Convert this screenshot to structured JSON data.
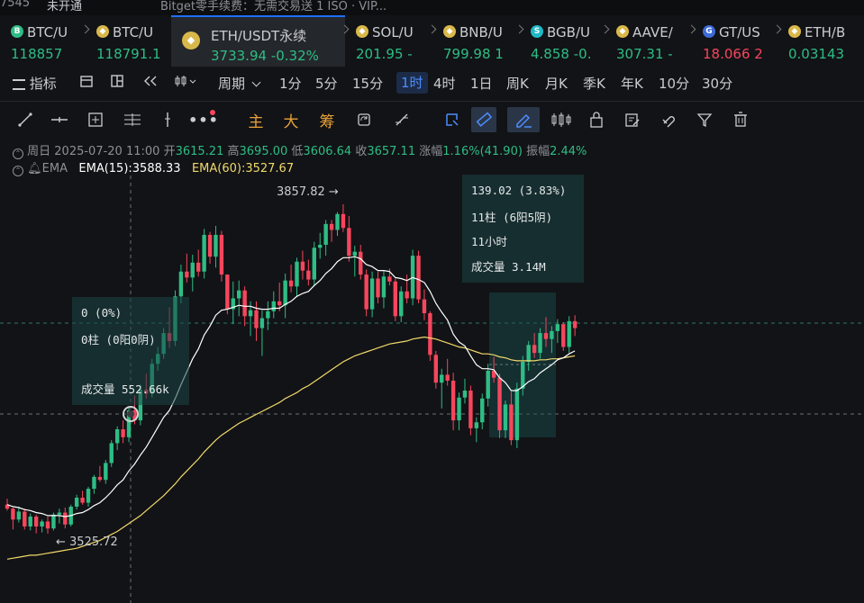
{
  "top_strip": {
    "left_text": "7545",
    "tab_label": "未开通",
    "notice": "Bitget零手续费：无需交易送 1 ISO · VIP..."
  },
  "tabs": [
    {
      "name": "BTC/U",
      "price": "118857",
      "change": "",
      "color": "#2ebd85",
      "icon": "b-coin-icon"
    },
    {
      "name": "BTC/U",
      "price": "118791.1",
      "change": "",
      "color": "#2ebd85",
      "icon": "bnb-coin-icon"
    },
    {
      "name": "ETH/USDT永续",
      "price": "3733.94",
      "change": "-0.32%",
      "color": "#2ebd85",
      "icon": "bnb-coin-icon",
      "active": true
    },
    {
      "name": "SOL/U",
      "price": "201.95",
      "change": "-",
      "color": "#2ebd85",
      "icon": "bnb-coin-icon"
    },
    {
      "name": "BNB/U",
      "price": "799.98",
      "change": "1",
      "color": "#2ebd85",
      "icon": "bnb-coin-icon"
    },
    {
      "name": "BGB/U",
      "price": "4.858",
      "change": "-0.",
      "color": "#2ebd85",
      "icon": "bgb-coin-icon"
    },
    {
      "name": "AAVE/",
      "price": "307.31",
      "change": "-",
      "color": "#2ebd85",
      "icon": "bnb-coin-icon"
    },
    {
      "name": "GT/US",
      "price": "18.066",
      "change": "2",
      "color": "#f6465d",
      "icon": "gt-coin-icon"
    },
    {
      "name": "ETH/B",
      "price": "0.03143",
      "change": "",
      "color": "#2ebd85",
      "icon": "bnb-coin-icon"
    }
  ],
  "toolbar": {
    "indicator_label": "指标",
    "period_label": "周期",
    "periods": [
      "1分",
      "5分",
      "15分",
      "1时",
      "4时",
      "1日",
      "周K",
      "月K",
      "季K",
      "年K",
      "10分",
      "30分"
    ],
    "selected_period": "1时"
  },
  "drawing_tools": {
    "text_tools": [
      "主",
      "大",
      "筹"
    ]
  },
  "ohlc": {
    "date": "周日 2025-07-20 11:00",
    "open_label": "开",
    "open": "3615.21",
    "high_label": "高",
    "high": "3695.00",
    "low_label": "低",
    "low": "3606.64",
    "close_label": "收",
    "close": "3657.11",
    "change_label": "涨幅",
    "change": "1.16%(41.90)",
    "amp_label": "振幅",
    "amp": "2.44%"
  },
  "ema": {
    "label": "EMA",
    "ema15_label": "EMA(15):",
    "ema15": "3588.33",
    "ema60_label": "EMA(60):",
    "ema60": "3527.67",
    "ema15_color": "#ffffff",
    "ema60_color": "#f0d96b"
  },
  "annotations": {
    "high_label": "3857.82 →",
    "low_label": "← 3525.72",
    "measure_left": {
      "line1": "0 (0%)",
      "line2": "0柱 (0阳0阴)",
      "line3": "成交量 552.66k"
    },
    "measure_right": {
      "line1": "139.02 (3.83%)",
      "line2": "11柱 (6阳5阴)",
      "line3": "11小时",
      "line4": "成交量 3.14M"
    }
  },
  "chart_data": {
    "type": "candlestick",
    "interval": "1h",
    "high": 3857.82,
    "low": 3525.72,
    "up_color": "#2ebd85",
    "down_color": "#f6465d",
    "ema_series": [
      {
        "name": "EMA(15)"
      },
      {
        "name": "EMA(60)"
      }
    ],
    "ohlc": [
      [
        3555,
        3561,
        3549,
        3551
      ],
      [
        3551,
        3552,
        3530,
        3540
      ],
      [
        3540,
        3553,
        3537,
        3548
      ],
      [
        3548,
        3551,
        3530,
        3533
      ],
      [
        3533,
        3546,
        3529,
        3543
      ],
      [
        3543,
        3545,
        3526,
        3533
      ],
      [
        3533,
        3540,
        3527,
        3538
      ],
      [
        3538,
        3543,
        3525.72,
        3531
      ],
      [
        3531,
        3547,
        3529,
        3545
      ],
      [
        3545,
        3551,
        3536,
        3547
      ],
      [
        3547,
        3552,
        3531,
        3535
      ],
      [
        3535,
        3555,
        3533,
        3553
      ],
      [
        3553,
        3565,
        3550,
        3562
      ],
      [
        3562,
        3569,
        3555,
        3557
      ],
      [
        3557,
        3573,
        3553,
        3571
      ],
      [
        3571,
        3585,
        3566,
        3583
      ],
      [
        3583,
        3594,
        3578,
        3580
      ],
      [
        3580,
        3600,
        3576,
        3597
      ],
      [
        3597,
        3620,
        3593,
        3617
      ],
      [
        3617,
        3634,
        3610,
        3631
      ],
      [
        3631,
        3640,
        3617,
        3623
      ],
      [
        3623,
        3654,
        3618,
        3650
      ],
      [
        3650,
        3665,
        3636,
        3640
      ],
      [
        3640,
        3676,
        3635,
        3671
      ],
      [
        3671,
        3687,
        3662,
        3667
      ],
      [
        3667,
        3702,
        3663,
        3697
      ],
      [
        3697,
        3714,
        3690,
        3707
      ],
      [
        3707,
        3733,
        3702,
        3728
      ],
      [
        3728,
        3754,
        3713,
        3720
      ],
      [
        3720,
        3771,
        3715,
        3765
      ],
      [
        3765,
        3797,
        3758,
        3790
      ],
      [
        3790,
        3808,
        3779,
        3784
      ],
      [
        3784,
        3807,
        3770,
        3799
      ],
      [
        3799,
        3812,
        3785,
        3790
      ],
      [
        3790,
        3833,
        3783,
        3827
      ],
      [
        3827,
        3830,
        3798,
        3805
      ],
      [
        3805,
        3836,
        3794,
        3827
      ],
      [
        3827,
        3831,
        3780,
        3787
      ],
      [
        3787,
        3787,
        3747,
        3752
      ],
      [
        3752,
        3780,
        3737,
        3763
      ],
      [
        3763,
        3781,
        3745,
        3771
      ],
      [
        3771,
        3775,
        3735,
        3745
      ],
      [
        3745,
        3760,
        3725,
        3751
      ],
      [
        3751,
        3760,
        3720,
        3733
      ],
      [
        3733,
        3751,
        3705,
        3743
      ],
      [
        3743,
        3760,
        3731,
        3750
      ],
      [
        3750,
        3770,
        3743,
        3760
      ],
      [
        3760,
        3779,
        3750,
        3756
      ],
      [
        3756,
        3788,
        3743,
        3781
      ],
      [
        3781,
        3797,
        3769,
        3775
      ],
      [
        3775,
        3804,
        3765,
        3800
      ],
      [
        3800,
        3811,
        3782,
        3791
      ],
      [
        3791,
        3802,
        3776,
        3782
      ],
      [
        3782,
        3820,
        3775,
        3814
      ],
      [
        3814,
        3829,
        3803,
        3817
      ],
      [
        3817,
        3842,
        3806,
        3838
      ],
      [
        3838,
        3842,
        3820,
        3832
      ],
      [
        3832,
        3850,
        3826,
        3848
      ],
      [
        3848,
        3857.82,
        3830,
        3834
      ],
      [
        3834,
        3846,
        3800,
        3806
      ],
      [
        3806,
        3816,
        3785,
        3810
      ],
      [
        3810,
        3817,
        3782,
        3787
      ],
      [
        3787,
        3792,
        3745,
        3752
      ],
      [
        3752,
        3790,
        3744,
        3783
      ],
      [
        3783,
        3790,
        3758,
        3764
      ],
      [
        3764,
        3791,
        3753,
        3785
      ],
      [
        3785,
        3793,
        3776,
        3780
      ],
      [
        3780,
        3783,
        3740,
        3745
      ],
      [
        3745,
        3775,
        3739,
        3770
      ],
      [
        3770,
        3787,
        3758,
        3763
      ],
      [
        3763,
        3812,
        3756,
        3806
      ],
      [
        3806,
        3811,
        3758,
        3762
      ],
      [
        3762,
        3772,
        3741,
        3748
      ],
      [
        3748,
        3750,
        3700,
        3706
      ],
      [
        3706,
        3710,
        3672,
        3678
      ],
      [
        3678,
        3692,
        3652,
        3686
      ],
      [
        3686,
        3702,
        3675,
        3680
      ],
      [
        3680,
        3688,
        3630,
        3640
      ],
      [
        3640,
        3668,
        3630,
        3663
      ],
      [
        3663,
        3682,
        3657,
        3670
      ],
      [
        3670,
        3675,
        3625,
        3632
      ],
      [
        3632,
        3643,
        3618,
        3638
      ],
      [
        3638,
        3667,
        3631,
        3662
      ],
      [
        3662,
        3697,
        3654,
        3690
      ],
      [
        3690,
        3704,
        3678,
        3683
      ],
      [
        3683,
        3687,
        3622,
        3630
      ],
      [
        3630,
        3660,
        3622,
        3656
      ],
      [
        3656,
        3669,
        3615,
        3620
      ],
      [
        3620,
        3678,
        3612,
        3672
      ],
      [
        3672,
        3705,
        3665,
        3699
      ],
      [
        3699,
        3720,
        3690,
        3716
      ],
      [
        3716,
        3728,
        3703,
        3708
      ],
      [
        3708,
        3733,
        3702,
        3728
      ],
      [
        3728,
        3744,
        3714,
        3722
      ],
      [
        3722,
        3735,
        3708,
        3730
      ],
      [
        3730,
        3742,
        3718,
        3737
      ],
      [
        3737,
        3739,
        3710,
        3714
      ],
      [
        3714,
        3745,
        3708,
        3740
      ],
      [
        3740,
        3746,
        3725,
        3733
      ]
    ],
    "ema15": [
      3555,
      3553,
      3552,
      3550,
      3549,
      3547,
      3546,
      3544,
      3544,
      3544,
      3543,
      3544,
      3546,
      3547,
      3550,
      3554,
      3557,
      3562,
      3568,
      3575,
      3580,
      3589,
      3596,
      3605,
      3613,
      3623,
      3633,
      3643,
      3650,
      3662,
      3676,
      3689,
      3702,
      3712,
      3726,
      3735,
      3746,
      3751,
      3752,
      3754,
      3756,
      3755,
      3755,
      3753,
      3752,
      3752,
      3753,
      3753,
      3757,
      3760,
      3765,
      3768,
      3770,
      3776,
      3781,
      3788,
      3793,
      3800,
      3804,
      3804,
      3805,
      3803,
      3797,
      3795,
      3791,
      3791,
      3790,
      3784,
      3783,
      3781,
      3784,
      3782,
      3779,
      3770,
      3758,
      3749,
      3741,
      3727,
      3719,
      3715,
      3705,
      3696,
      3692,
      3692,
      3691,
      3683,
      3678,
      3670,
      3670,
      3674,
      3679,
      3682,
      3688,
      3692,
      3696,
      3701,
      3703,
      3707,
      3710
    ],
    "ema60": [
      3500,
      3501,
      3502,
      3503,
      3504,
      3504,
      3505,
      3506,
      3507,
      3508,
      3509,
      3510,
      3511,
      3513,
      3515,
      3517,
      3519,
      3522,
      3525,
      3528,
      3532,
      3536,
      3540,
      3544,
      3549,
      3554,
      3559,
      3564,
      3570,
      3576,
      3583,
      3589,
      3595,
      3601,
      3608,
      3614,
      3620,
      3625,
      3629,
      3633,
      3637,
      3640,
      3643,
      3646,
      3649,
      3652,
      3655,
      3658,
      3662,
      3665,
      3668,
      3672,
      3675,
      3679,
      3683,
      3687,
      3691,
      3695,
      3699,
      3702,
      3705,
      3707,
      3709,
      3711,
      3713,
      3715,
      3717,
      3718,
      3719,
      3720,
      3722,
      3723,
      3724,
      3723,
      3722,
      3720,
      3718,
      3716,
      3714,
      3713,
      3711,
      3709,
      3707,
      3707,
      3706,
      3704,
      3703,
      3701,
      3700,
      3700,
      3700,
      3700,
      3701,
      3701,
      3702,
      3702,
      3703,
      3704,
      3705
    ]
  }
}
